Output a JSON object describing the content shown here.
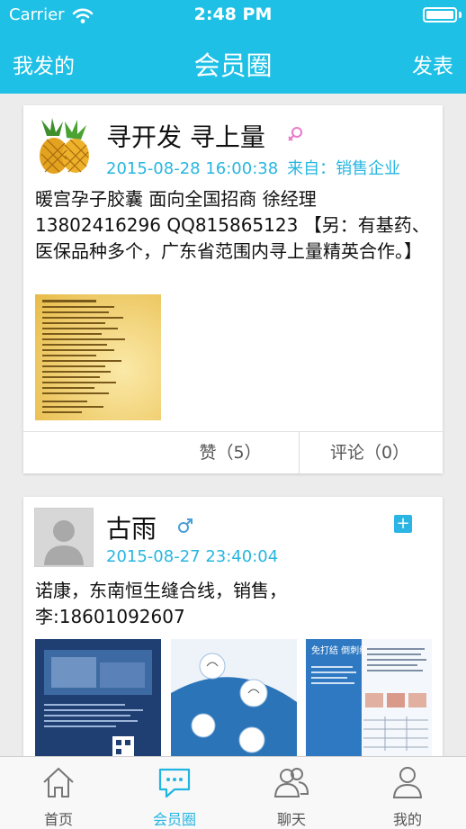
{
  "status_bar": {
    "carrier": "Carrier",
    "time": "2:48 PM"
  },
  "nav": {
    "left": "我发的",
    "title": "会员圈",
    "right": "发表"
  },
  "posts": [
    {
      "name": "寻开发 寻上量",
      "gender": "female",
      "time": "2015-08-28 16:00:38",
      "source": "来自：销售企业",
      "content": "暖宫孕子胶囊 面向全国招商 徐经理13802416296 QQ815865123 【另：有基药、医保品种多个，广东省范围内寻上量精英合作。】",
      "likes": "赞（5）",
      "comments": "评论（0）"
    },
    {
      "name": "古雨",
      "gender": "male",
      "time": "2015-08-27 23:40:04",
      "content": "诺康，东南恒生缝合线，销售，李:18601092607",
      "thumb3_title": "免打结 倒刺线"
    }
  ],
  "tabs": [
    {
      "label": "首页"
    },
    {
      "label": "会员圈"
    },
    {
      "label": "聊天"
    },
    {
      "label": "我的"
    }
  ],
  "colors": {
    "accent": "#1ec0e6",
    "link": "#27b6e0",
    "female": "#e979c8",
    "male": "#4a9fd8"
  }
}
